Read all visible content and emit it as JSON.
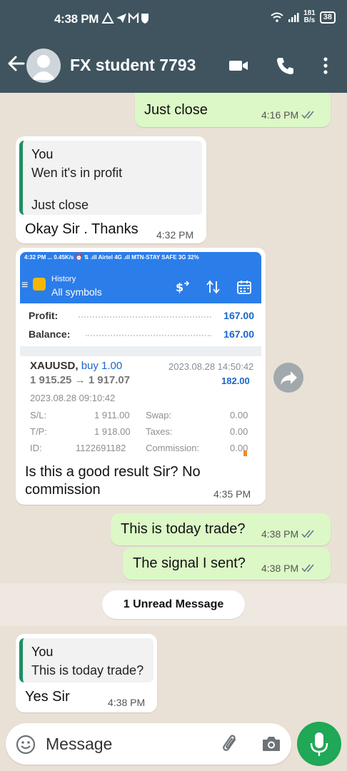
{
  "status": {
    "time": "4:38 PM",
    "net_speed_top": "181",
    "net_speed_bottom": "B/s",
    "battery": "38"
  },
  "header": {
    "contact_name": "FX student 7793"
  },
  "messages": {
    "m1": {
      "text": "Just close",
      "time": "4:16 PM"
    },
    "m2": {
      "quote_author": "You",
      "quote_line1": "Wen it's in profit",
      "quote_line2": "Just close",
      "text": "Okay Sir . Thanks",
      "time": "4:32 PM"
    },
    "m3": {
      "text_line1": "Is this a good result Sir? No",
      "text_line2": "commission",
      "time": "4:35 PM",
      "screenshot": {
        "status": "4:32 PM  ...   0.45K/s  ⏰  ⇅  .ıll  Airtel 4G  .ıll  MTN-STAY SAFE 3G   32%",
        "title_small": "History",
        "title_main": "All symbols",
        "profit_label": "Profit:",
        "profit_value": "167.00",
        "balance_label": "Balance:",
        "balance_value": "167.00",
        "symbol": "XAUUSD,",
        "side": "buy 1.00",
        "close_datetime": "2023.08.28 14:50:42",
        "price_line": "1 915.25 → 1 917.07",
        "trade_profit": "182.00",
        "open_datetime": "2023.08.28 09:10:42",
        "sl_label": "S/L:",
        "sl_value": "1 911.00",
        "tp_label": "T/P:",
        "tp_value": "1 918.00",
        "id_label": "ID:",
        "id_value": "1122691182",
        "swap_label": "Swap:",
        "swap_value": "0.00",
        "taxes_label": "Taxes:",
        "taxes_value": "0.00",
        "comm_label": "Commission:",
        "comm_value": "0.00"
      }
    },
    "m4": {
      "text": "This is today trade?",
      "time": "4:38 PM"
    },
    "m5": {
      "text": "The signal I sent?",
      "time": "4:38 PM"
    },
    "m6": {
      "quote_author": "You",
      "quote_line1": "This is today trade?",
      "text": "Yes Sir",
      "time": "4:38 PM"
    }
  },
  "unread_label": "1 Unread Message",
  "input": {
    "placeholder": "Message"
  },
  "colors": {
    "header_bg": "#3f545f",
    "outgoing_bubble": "#dcf8c6",
    "incoming_bubble": "#ffffff",
    "quote_bar": "#1f8f62",
    "mic_button": "#1fa855",
    "read_ticks": "#5f7a8a"
  },
  "icons": [
    "back-arrow-icon",
    "video-call-icon",
    "phone-icon",
    "more-vert-icon",
    "forward-icon",
    "emoji-icon",
    "attach-icon",
    "camera-icon",
    "mic-icon",
    "read-ticks-icon"
  ]
}
